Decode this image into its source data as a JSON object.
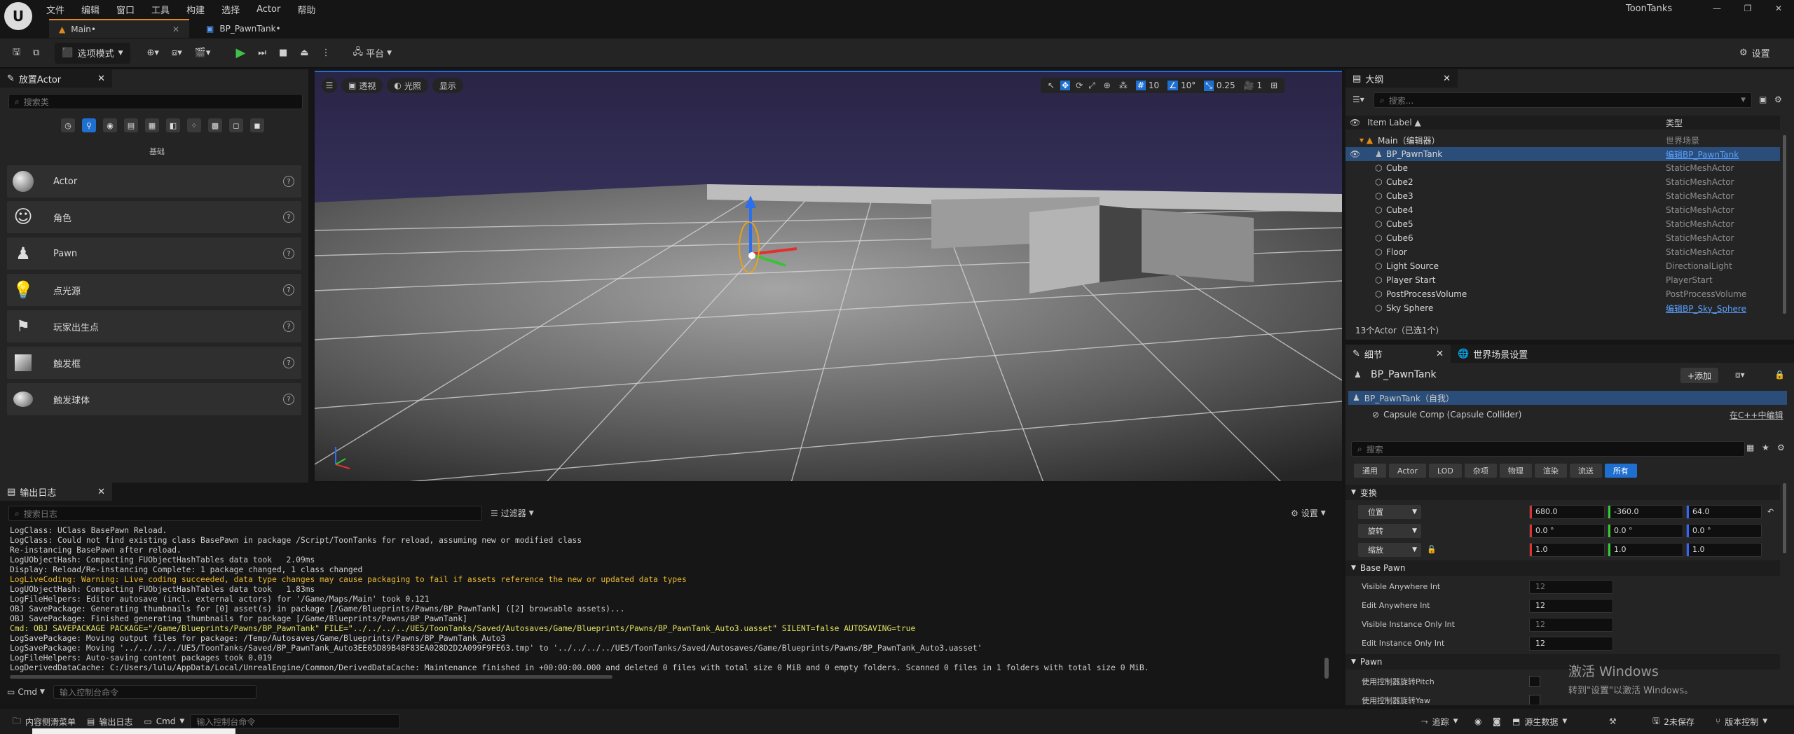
{
  "menu": [
    "文件",
    "编辑",
    "窗口",
    "工具",
    "构建",
    "选择",
    "Actor",
    "帮助"
  ],
  "project_name": "ToonTanks",
  "doc_tabs": [
    {
      "label": "Main•"
    },
    {
      "label": "BP_PawnTank•"
    }
  ],
  "toolbar": {
    "select_mode": "选项模式",
    "platform": "平台",
    "settings": "设置"
  },
  "place_actors": {
    "title": "放置Actor",
    "search_placeholder": "搜索类",
    "category_label": "基础",
    "items": [
      {
        "label": "Actor"
      },
      {
        "label": "角色"
      },
      {
        "label": "Pawn"
      },
      {
        "label": "点光源"
      },
      {
        "label": "玩家出生点"
      },
      {
        "label": "触发框"
      },
      {
        "label": "触发球体"
      }
    ]
  },
  "viewport": {
    "perspective": "透视",
    "lighting": "光照",
    "show": "显示",
    "grid_snap": "10",
    "rot_snap": "10°",
    "scale_snap": "0.25",
    "camera_speed": "1"
  },
  "outliner": {
    "title": "大纲",
    "search_placeholder": "搜索...",
    "col_label": "Item Label ▲",
    "col_type": "类型",
    "rows": [
      {
        "label": "Main（编辑器）",
        "type": "世界场景",
        "link": false
      },
      {
        "label": "BP_PawnTank",
        "type": "编辑BP_PawnTank",
        "link": true,
        "selected": true
      },
      {
        "label": "Cube",
        "type": "StaticMeshActor",
        "link": false
      },
      {
        "label": "Cube2",
        "type": "StaticMeshActor",
        "link": false
      },
      {
        "label": "Cube3",
        "type": "StaticMeshActor",
        "link": false
      },
      {
        "label": "Cube4",
        "type": "StaticMeshActor",
        "link": false
      },
      {
        "label": "Cube5",
        "type": "StaticMeshActor",
        "link": false
      },
      {
        "label": "Cube6",
        "type": "StaticMeshActor",
        "link": false
      },
      {
        "label": "Floor",
        "type": "StaticMeshActor",
        "link": false
      },
      {
        "label": "Light Source",
        "type": "DirectionalLight",
        "link": false
      },
      {
        "label": "Player Start",
        "type": "PlayerStart",
        "link": false
      },
      {
        "label": "PostProcessVolume",
        "type": "PostProcessVolume",
        "link": false
      },
      {
        "label": "Sky Sphere",
        "type": "编辑BP_Sky_Sphere",
        "link": true
      }
    ],
    "footer": "13个Actor（已选1个）"
  },
  "details": {
    "tab_details": "细节",
    "tab_world": "世界场景设置",
    "actor_name": "BP_PawnTank",
    "add_label": "+添加",
    "self_row": "BP_PawnTank（自我）",
    "component": "Capsule Comp (Capsule Collider)",
    "open_cpp": "在C++中编辑",
    "search_placeholder": "搜索",
    "filters": [
      "通用",
      "Actor",
      "LOD",
      "杂项",
      "物理",
      "渲染",
      "流送",
      "所有"
    ],
    "transform_title": "变换",
    "location_label": "位置",
    "location": [
      "680.0",
      "-360.0",
      "64.0"
    ],
    "rotation_label": "旋转",
    "rotation": [
      "0.0 °",
      "0.0 °",
      "0.0 °"
    ],
    "scale_label": "缩放",
    "scale": [
      "1.0",
      "1.0",
      "1.0"
    ],
    "base_pawn_title": "Base Pawn",
    "base_pawn_props": [
      {
        "label": "Visible Anywhere Int",
        "value": "12",
        "dim": true
      },
      {
        "label": "Edit Anywhere Int",
        "value": "12",
        "dim": false
      },
      {
        "label": "Visible Instance Only Int",
        "value": "12",
        "dim": true
      },
      {
        "label": "Edit Instance Only Int",
        "value": "12",
        "dim": false
      }
    ],
    "pawn_title": "Pawn",
    "pawn_prop": "使用控制器旋转Pitch",
    "pawn_prop2": "使用控制器旋转Yaw"
  },
  "watermark": {
    "line1": "激活 Windows",
    "line2": "转到\"设置\"以激活 Windows。"
  },
  "output_log": {
    "title": "输出日志",
    "search_placeholder": "搜索日志",
    "filter_label": "过滤器",
    "settings_label": "设置",
    "lines": [
      {
        "text": "LogClass: UClass BasePawn Reload.",
        "kind": "normal"
      },
      {
        "text": "LogClass: Could not find existing class BasePawn in package /Script/ToonTanks for reload, assuming new or modified class",
        "kind": "normal"
      },
      {
        "text": "Re-instancing BasePawn after reload.",
        "kind": "normal"
      },
      {
        "text": "LogUObjectHash: Compacting FUObjectHashTables data took   2.09ms",
        "kind": "normal"
      },
      {
        "text": "Display: Reload/Re-instancing Complete: 1 package changed, 1 class changed",
        "kind": "normal"
      },
      {
        "text": "LogLiveCoding: Warning: Live coding succeeded, data type changes may cause packaging to fail if assets reference the new or updated data types",
        "kind": "warn"
      },
      {
        "text": "LogUObjectHash: Compacting FUObjectHashTables data took   1.83ms",
        "kind": "normal"
      },
      {
        "text": "LogFileHelpers: Editor autosave (incl. external actors) for '/Game/Maps/Main' took 0.121",
        "kind": "normal"
      },
      {
        "text": "OBJ SavePackage: Generating thumbnails for [0] asset(s) in package [/Game/Blueprints/Pawns/BP_PawnTank] ([2] browsable assets)...",
        "kind": "normal"
      },
      {
        "text": "OBJ SavePackage: Finished generating thumbnails for package [/Game/Blueprints/Pawns/BP_PawnTank]",
        "kind": "normal"
      },
      {
        "text": "Cmd: OBJ SAVEPACKAGE PACKAGE=\"/Game/Blueprints/Pawns/BP_PawnTank\" FILE=\"../../../../UE5/ToonTanks/Saved/Autosaves/Game/Blueprints/Pawns/BP_PawnTank_Auto3.uasset\" SILENT=false AUTOSAVING=true",
        "kind": "cmd"
      },
      {
        "text": "LogSavePackage: Moving output files for package: /Temp/Autosaves/Game/Blueprints/Pawns/BP_PawnTank_Auto3",
        "kind": "normal"
      },
      {
        "text": "LogSavePackage: Moving '../../../../UE5/ToonTanks/Saved/BP_PawnTank_Auto3EE05D89B48F83EA028D2D2A099F9FE63.tmp' to '../../../../UE5/ToonTanks/Saved/Autosaves/Game/Blueprints/Pawns/BP_PawnTank_Auto3.uasset'",
        "kind": "normal"
      },
      {
        "text": "LogFileHelpers: Auto-saving content packages took 0.019",
        "kind": "normal"
      },
      {
        "text": "LogDerivedDataCache: C:/Users/lulu/AppData/Local/UnrealEngine/Common/DerivedDataCache: Maintenance finished in +00:00:00.000 and deleted 0 files with total size 0 MiB and 0 empty folders. Scanned 0 files in 1 folders with total size 0 MiB.",
        "kind": "normal"
      }
    ],
    "cmd_label": "Cmd",
    "cmd_placeholder": "输入控制台命令"
  },
  "statusbar": {
    "content_drawer": "内容侧滑菜单",
    "output_log": "输出日志",
    "cmd": "Cmd",
    "cmd_placeholder": "输入控制台命令",
    "trace": "追踪",
    "source_control": "源生数据",
    "unsaved": "2未保存",
    "version_control": "版本控制"
  }
}
